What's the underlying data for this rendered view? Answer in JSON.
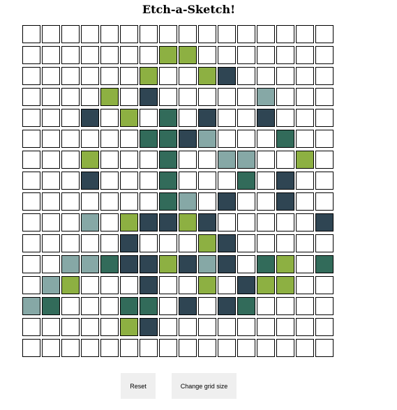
{
  "title": "Etch-a-Sketch!",
  "palette": {
    "0": "#ffffff",
    "1": "#8db042",
    "2": "#2f4553",
    "3": "#326b5a",
    "4": "#86a8a6"
  },
  "grid": {
    "size": 16,
    "rows": [
      "0000000000000000",
      "0000000110000000",
      "0000001001200000",
      "0000102000004000",
      "0002010302002000",
      "0000003324000300",
      "0001000300440010",
      "0002000300030200",
      "0000000340200200",
      "0004012212000002",
      "0000020001200000",
      "0044322124203103",
      "0410002001021100",
      "4300033020230000",
      "0000012000000000",
      "0000000000000000"
    ]
  },
  "buttons": {
    "reset": "Reset",
    "change_size": "Change grid size"
  }
}
